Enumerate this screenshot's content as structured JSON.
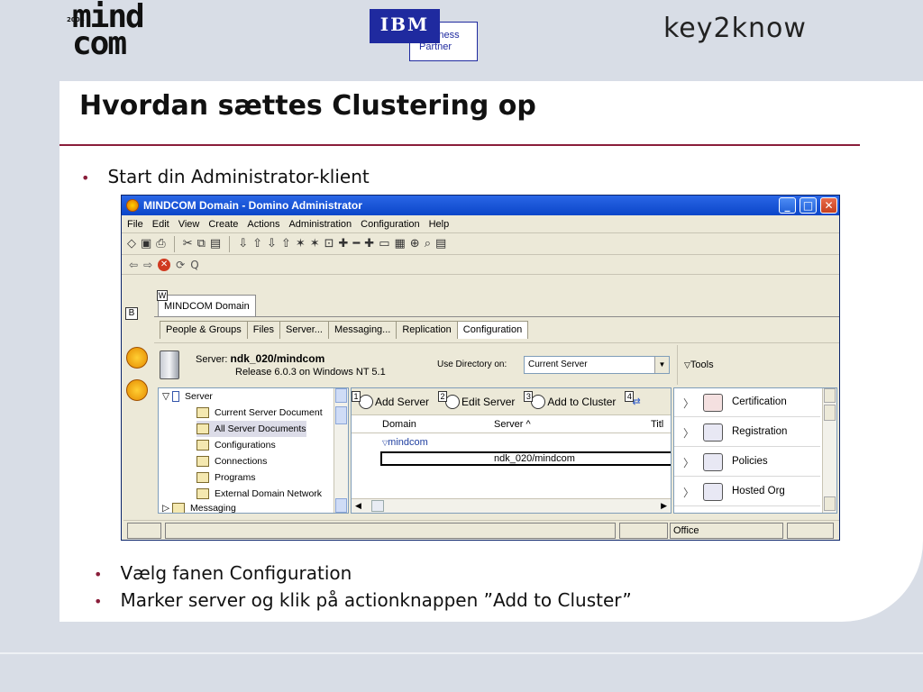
{
  "logos": {
    "mindcom_line1": "mind",
    "mindcom_line2": "com",
    "mindcom_year": "2004",
    "ibm": "IBM",
    "ibm_partner_line1": "Business",
    "ibm_partner_line2": "Partner",
    "key2know": "key2know"
  },
  "slide": {
    "title": "Hvordan sættes Clustering op",
    "bullet1": "Start din Administrator-klient",
    "bullet2": "Vælg fanen Configuration",
    "bullet3": "Marker server og klik på actionknappen ”Add to Cluster”",
    "bullet_mark": "•",
    "accent_color": "#8a1e3a"
  },
  "window": {
    "title": "MINDCOM Domain - Domino Administrator",
    "title_color": "#0b46c9",
    "controls": {
      "minimize": "_",
      "maximize": "□",
      "close": "✕"
    },
    "menu": [
      "File",
      "Edit",
      "View",
      "Create",
      "Actions",
      "Administration",
      "Configuration",
      "Help"
    ],
    "toolbar_icons": [
      "new-icon",
      "save-icon",
      "print-icon",
      "cut-icon",
      "copy-icon",
      "paste-icon",
      "move-down-icon",
      "move-up-icon",
      "arrow-down-icon",
      "arrow-up-icon",
      "star-down-icon",
      "star-up-icon",
      "refresh-icon",
      "expand-icon",
      "collapse-icon",
      "expand-all-icon",
      "collapse-all-icon",
      "bookmark-icon",
      "find-icon",
      "search-icon",
      "properties-icon"
    ],
    "nav_glyphs": {
      "back": "⇦",
      "forward": "⇨",
      "stop": "✕",
      "refresh": "⟳",
      "search": "Q"
    },
    "doc_tab": {
      "label": "MINDCOM Domain",
      "badge": "W"
    },
    "strip_badge": "B",
    "subtabs": [
      "People & Groups",
      "Files",
      "Server...",
      "Messaging...",
      "Replication",
      "Configuration"
    ],
    "active_subtab": "Configuration",
    "server": {
      "prefix": "Server:",
      "name": "ndk_020/mindcom",
      "release": "Release 6.0.3 on Windows NT 5.1",
      "use_directory_label": "Use Directory on:",
      "directory_value": "Current Server",
      "tools_label": "Tools"
    },
    "tree": {
      "root": "Server",
      "items": [
        "Current Server Document",
        "All Server Documents",
        "Configurations",
        "Connections",
        "Programs",
        "External Domain Network"
      ],
      "selected": "All Server Documents",
      "next_root": "Messaging"
    },
    "actions": [
      {
        "num": "1",
        "label": "Add Server"
      },
      {
        "num": "2",
        "label": "Edit Server"
      },
      {
        "num": "3",
        "label": "Add to Cluster"
      },
      {
        "num": "4",
        "label": ""
      }
    ],
    "columns": [
      "Domain",
      "Server ^",
      "Titl"
    ],
    "rows": [
      {
        "domain": "mindcom",
        "server": ""
      },
      {
        "domain": "",
        "server": "ndk_020/mindcom"
      }
    ],
    "tools": [
      "Certification",
      "Registration",
      "Policies",
      "Hosted Org"
    ],
    "status": {
      "location": "Office"
    }
  }
}
